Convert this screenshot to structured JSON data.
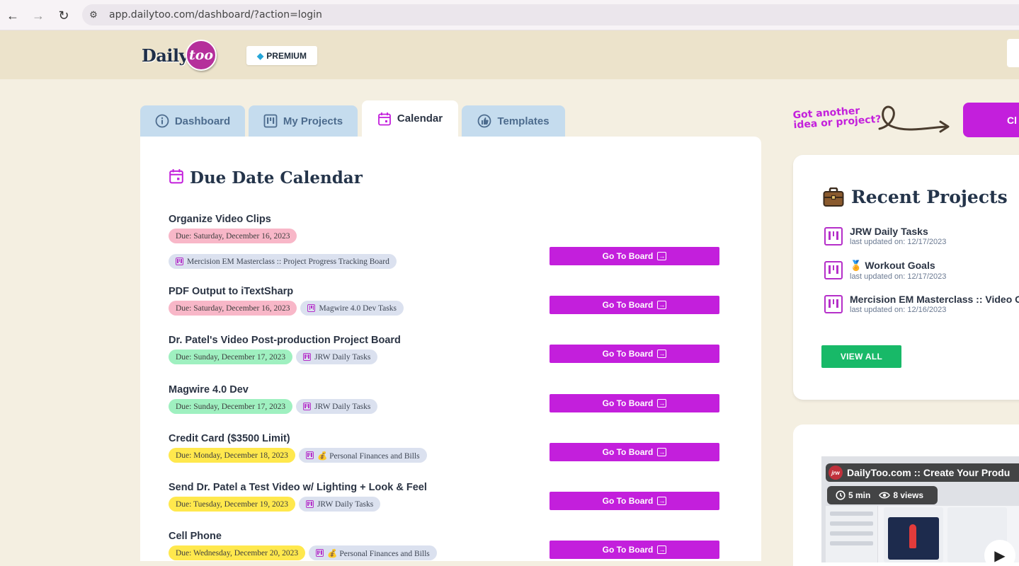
{
  "browser": {
    "url": "app.dailytoo.com/dashboard/?action=login"
  },
  "header": {
    "logo_daily": "Daily",
    "logo_too": "too",
    "premium_label": "PREMIUM"
  },
  "tabs": [
    {
      "label": "Dashboard",
      "icon": "info-icon"
    },
    {
      "label": "My Projects",
      "icon": "board-icon"
    },
    {
      "label": "Calendar",
      "icon": "calendar-icon",
      "active": true
    },
    {
      "label": "Templates",
      "icon": "thumbs-up-icon"
    }
  ],
  "calendar": {
    "title": "Due Date Calendar",
    "go_label": "Go To Board",
    "tasks": [
      {
        "name": "Organize Video Clips",
        "due": "Due: Saturday, December 16, 2023",
        "due_color": "pink",
        "board": "Mercision EM Masterclass :: Project Progress Tracking Board"
      },
      {
        "name": "PDF Output to iTextSharp",
        "due": "Due: Saturday, December 16, 2023",
        "due_color": "pink",
        "board": "Magwire 4.0 Dev Tasks"
      },
      {
        "name": "Dr. Patel's Video Post-production Project Board",
        "due": "Due: Sunday, December 17, 2023",
        "due_color": "green",
        "board": "JRW Daily Tasks"
      },
      {
        "name": "Magwire 4.0 Dev",
        "due": "Due: Sunday, December 17, 2023",
        "due_color": "green",
        "board": "JRW Daily Tasks"
      },
      {
        "name": "Credit Card ($3500 Limit)",
        "due": "Due: Monday, December 18, 2023",
        "due_color": "yellow",
        "board": "💰 Personal Finances and Bills"
      },
      {
        "name": "Send Dr. Patel a Test Video w/ Lighting + Look & Feel",
        "due": "Due: Tuesday, December 19, 2023",
        "due_color": "yellow",
        "board": "JRW Daily Tasks"
      },
      {
        "name": "Cell Phone",
        "due": "Due: Wednesday, December 20, 2023",
        "due_color": "yellow",
        "board": "💰 Personal Finances and Bills"
      }
    ]
  },
  "sidebar": {
    "idea_line1": "Got another",
    "idea_line2": "idea or project?",
    "create_label": "Cl",
    "recent_title": "Recent Projects",
    "recent_projects": [
      {
        "title": "JRW Daily Tasks",
        "updated": "last updated on: 12/17/2023"
      },
      {
        "title": "🏅 Workout Goals",
        "updated": "last updated on: 12/17/2023"
      },
      {
        "title": "Mercision EM Masterclass :: Video O",
        "updated": "last updated on: 12/16/2023"
      }
    ],
    "view_all_label": "VIEW ALL",
    "video": {
      "logo": "jrw",
      "title": "DailyToo.com :: Create Your Produ",
      "duration": "5 min",
      "views": "8 views"
    }
  }
}
